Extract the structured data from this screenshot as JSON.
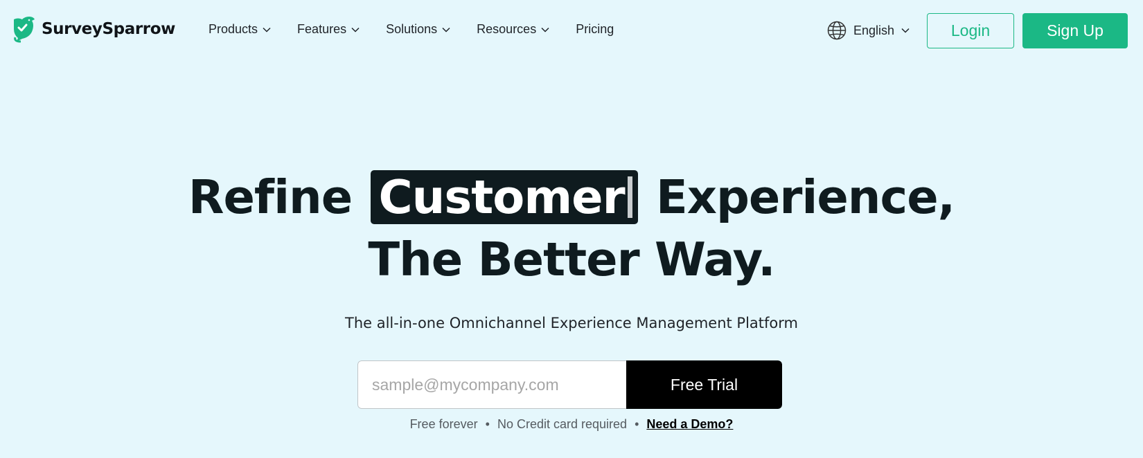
{
  "brand": {
    "name": "SurveySparrow",
    "accent_color": "#1bb885",
    "logo_icon": "sparrow-check-icon"
  },
  "nav": {
    "items": [
      {
        "label": "Products",
        "has_dropdown": true
      },
      {
        "label": "Features",
        "has_dropdown": true
      },
      {
        "label": "Solutions",
        "has_dropdown": true
      },
      {
        "label": "Resources",
        "has_dropdown": true
      },
      {
        "label": "Pricing",
        "has_dropdown": false
      }
    ],
    "language": {
      "label": "English",
      "icon": "globe-icon"
    },
    "login_label": "Login",
    "signup_label": "Sign Up"
  },
  "hero": {
    "headline_part1": "Refine",
    "headline_highlight": "Customer",
    "headline_part2": "Experience,",
    "headline_line2": "The Better Way.",
    "subtitle": "The all-in-one Omnichannel Experience Management Platform"
  },
  "signup_form": {
    "email_placeholder": "sample@mycompany.com",
    "email_value": "",
    "submit_label": "Free Trial"
  },
  "footnote": {
    "item1": "Free forever",
    "separator": "•",
    "item2": "No Credit card required",
    "demo_link": "Need a Demo?"
  }
}
